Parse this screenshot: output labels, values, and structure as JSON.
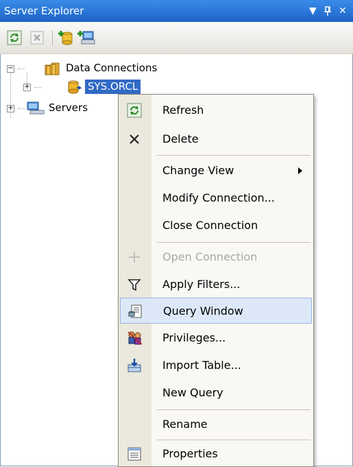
{
  "panel": {
    "title": "Server Explorer",
    "dropdown_glyph": "▼",
    "pin_glyph": "ᵽ",
    "close_glyph": "✕"
  },
  "toolbar": {
    "buttons": [
      "refresh-icon",
      "stop-refresh-icon",
      "add-connection-icon",
      "connect-to-server-icon"
    ]
  },
  "tree": {
    "root": {
      "label": "Data Connections",
      "expander": "−"
    },
    "child": {
      "label": "SYS.ORCL",
      "expander": "+"
    },
    "servers": {
      "label": "Servers",
      "expander": "+"
    }
  },
  "context_menu": {
    "items": [
      {
        "label": "Refresh",
        "icon": "refresh-icon"
      },
      {
        "label": "Delete",
        "icon": "delete-icon"
      },
      {
        "label": "Change View",
        "submenu": true
      },
      {
        "label": "Modify Connection..."
      },
      {
        "label": "Close Connection"
      },
      {
        "label": "Open Connection",
        "disabled": true,
        "icon": "plug-icon"
      },
      {
        "label": "Apply Filters...",
        "icon": "filter-icon"
      },
      {
        "label": "Query Window",
        "icon": "query-window-icon",
        "highlighted": true
      },
      {
        "label": "Privileges...",
        "icon": "privileges-icon"
      },
      {
        "label": "Import Table...",
        "icon": "import-table-icon"
      },
      {
        "label": "New Query"
      },
      {
        "label": "Rename"
      },
      {
        "label": "Properties",
        "icon": "properties-icon"
      }
    ]
  },
  "colors": {
    "title_bar": "#2a78dc",
    "selection": "#316ac5",
    "menu_hover": "#dce8f8"
  }
}
